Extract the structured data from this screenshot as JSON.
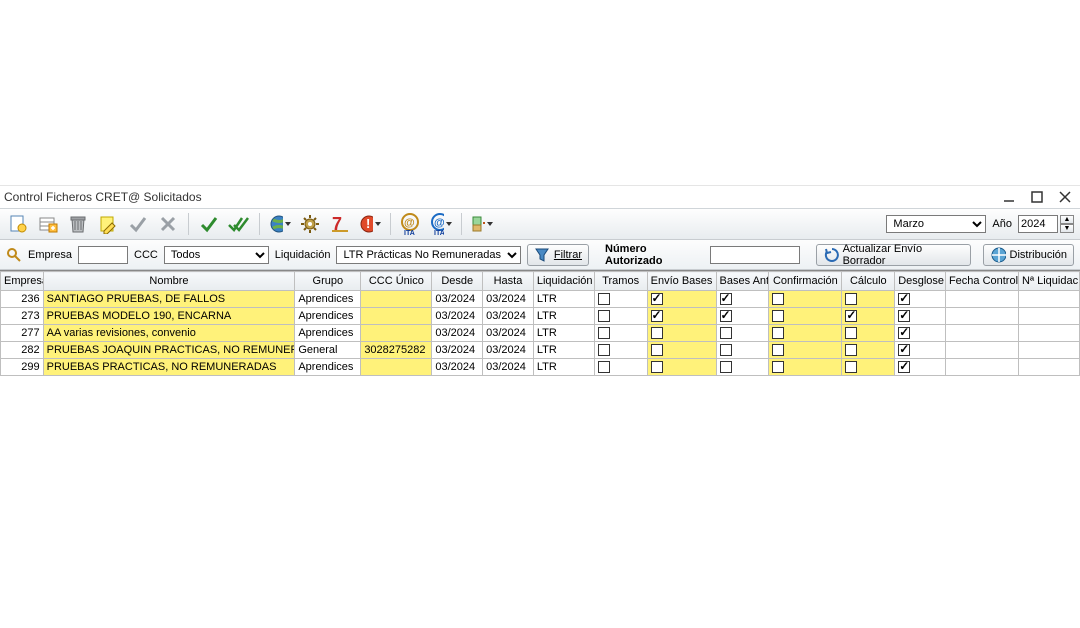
{
  "window": {
    "title": "Control Ficheros CRET@ Solicitados"
  },
  "toolbar": {
    "month_options": [
      "Marzo"
    ],
    "month_value": "Marzo",
    "year_label": "Año",
    "year_value": "2024"
  },
  "filterbar": {
    "empresa_label": "Empresa",
    "empresa_value": "",
    "ccc_label": "CCC",
    "ccc_value": "Todos",
    "liquidacion_label": "Liquidación",
    "liquidacion_value": "LTR Prácticas No Remuneradas",
    "filtrar_label": "Filtrar",
    "num_autorizado_label": "Número Autorizado",
    "num_autorizado_value": "",
    "actualizar_label": "Actualizar Envío Borrador",
    "distribucion_label": "Distribución"
  },
  "columns": {
    "empresa": "Empresa",
    "nombre": "Nombre",
    "grupo": "Grupo",
    "ccc_unico": "CCC Único",
    "desde": "Desde",
    "hasta": "Hasta",
    "liquidacion": "Liquidación",
    "tramos": "Tramos",
    "envio_bases": "Envío Bases",
    "bases_ant": "Bases Ant.",
    "confirmacion": "Confirmación",
    "calculo": "Cálculo",
    "desglose": "Desglose",
    "fecha_control": "Fecha Control",
    "n_liquidacion": "Nª Liquidac"
  },
  "rows": [
    {
      "empresa": "236",
      "nombre": "SANTIAGO PRUEBAS, DE FALLOS",
      "grupo": "Aprendices",
      "ccc_unico": "",
      "desde": "03/2024",
      "hasta": "03/2024",
      "liquidacion": "LTR",
      "tramos": false,
      "envio_bases": true,
      "bases_ant": true,
      "confirmacion": false,
      "calculo": false,
      "desglose": true,
      "nombre_hl": true
    },
    {
      "empresa": "273",
      "nombre": "PRUEBAS MODELO 190, ENCARNA",
      "grupo": "Aprendices",
      "ccc_unico": "",
      "desde": "03/2024",
      "hasta": "03/2024",
      "liquidacion": "LTR",
      "tramos": false,
      "envio_bases": true,
      "bases_ant": true,
      "confirmacion": false,
      "calculo": true,
      "desglose": true,
      "nombre_hl": true
    },
    {
      "empresa": "277",
      "nombre": "AA varias revisiones, convenio",
      "grupo": "Aprendices",
      "ccc_unico": "",
      "desde": "03/2024",
      "hasta": "03/2024",
      "liquidacion": "LTR",
      "tramos": false,
      "envio_bases": false,
      "bases_ant": false,
      "confirmacion": false,
      "calculo": false,
      "desglose": true,
      "nombre_hl": true
    },
    {
      "empresa": "282",
      "nombre": "PRUEBAS JOAQUIN PRACTICAS, NO REMUNERA",
      "grupo": "General",
      "ccc_unico": "3028275282",
      "desde": "03/2024",
      "hasta": "03/2024",
      "liquidacion": "LTR",
      "tramos": false,
      "envio_bases": false,
      "bases_ant": false,
      "confirmacion": false,
      "calculo": false,
      "desglose": true,
      "nombre_hl": true
    },
    {
      "empresa": "299",
      "nombre": "PRUEBAS PRACTICAS, NO REMUNERADAS",
      "grupo": "Aprendices",
      "ccc_unico": "",
      "desde": "03/2024",
      "hasta": "03/2024",
      "liquidacion": "LTR",
      "tramos": false,
      "envio_bases": false,
      "bases_ant": false,
      "confirmacion": false,
      "calculo": false,
      "desglose": true,
      "nombre_hl": true
    }
  ]
}
